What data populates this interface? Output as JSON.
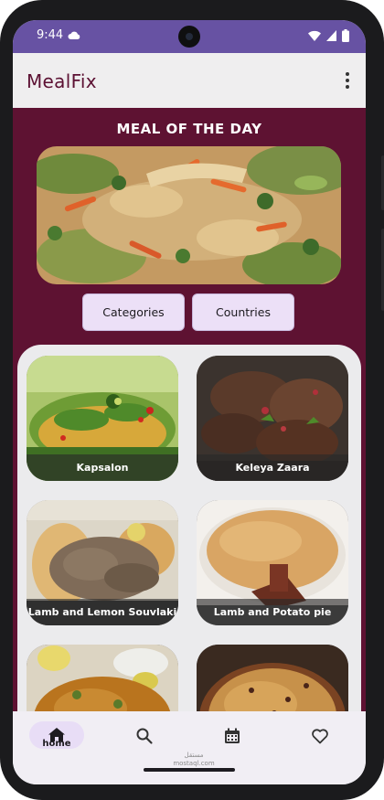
{
  "status_bar": {
    "time": "9:44",
    "cloud_icon": "cloud-icon",
    "wifi_icon": "wifi-icon",
    "signal_icon": "signal-icon",
    "battery_icon": "battery-icon",
    "color": "#6752a3"
  },
  "app_bar": {
    "title": "MealFix",
    "more_icon": "more-vert-icon",
    "title_color": "#5c1133"
  },
  "meal_of_the_day": {
    "heading": "MEAL OF THE DAY",
    "image": "fried-rice-dish-photo"
  },
  "filters": {
    "categories_label": "Categories",
    "countries_label": "Countries"
  },
  "meals": [
    {
      "name": "Kapsalon"
    },
    {
      "name": "Keleya Zaara"
    },
    {
      "name": "Lamb and Lemon Souvlaki"
    },
    {
      "name": "Lamb and Potato pie"
    },
    {
      "name": ""
    },
    {
      "name": ""
    }
  ],
  "bottom_nav": {
    "items": [
      {
        "label": "home",
        "icon": "home-icon",
        "active": true
      },
      {
        "label": "",
        "icon": "search-icon",
        "active": false
      },
      {
        "label": "",
        "icon": "calendar-icon",
        "active": false
      },
      {
        "label": "",
        "icon": "heart-icon",
        "active": false
      }
    ]
  },
  "watermark": {
    "line1": "مستقل",
    "line2": "mostaql.com"
  },
  "colors": {
    "content_background": "#5e1232",
    "pill_background": "#ece0f7",
    "nav_background": "#f1eef4"
  }
}
